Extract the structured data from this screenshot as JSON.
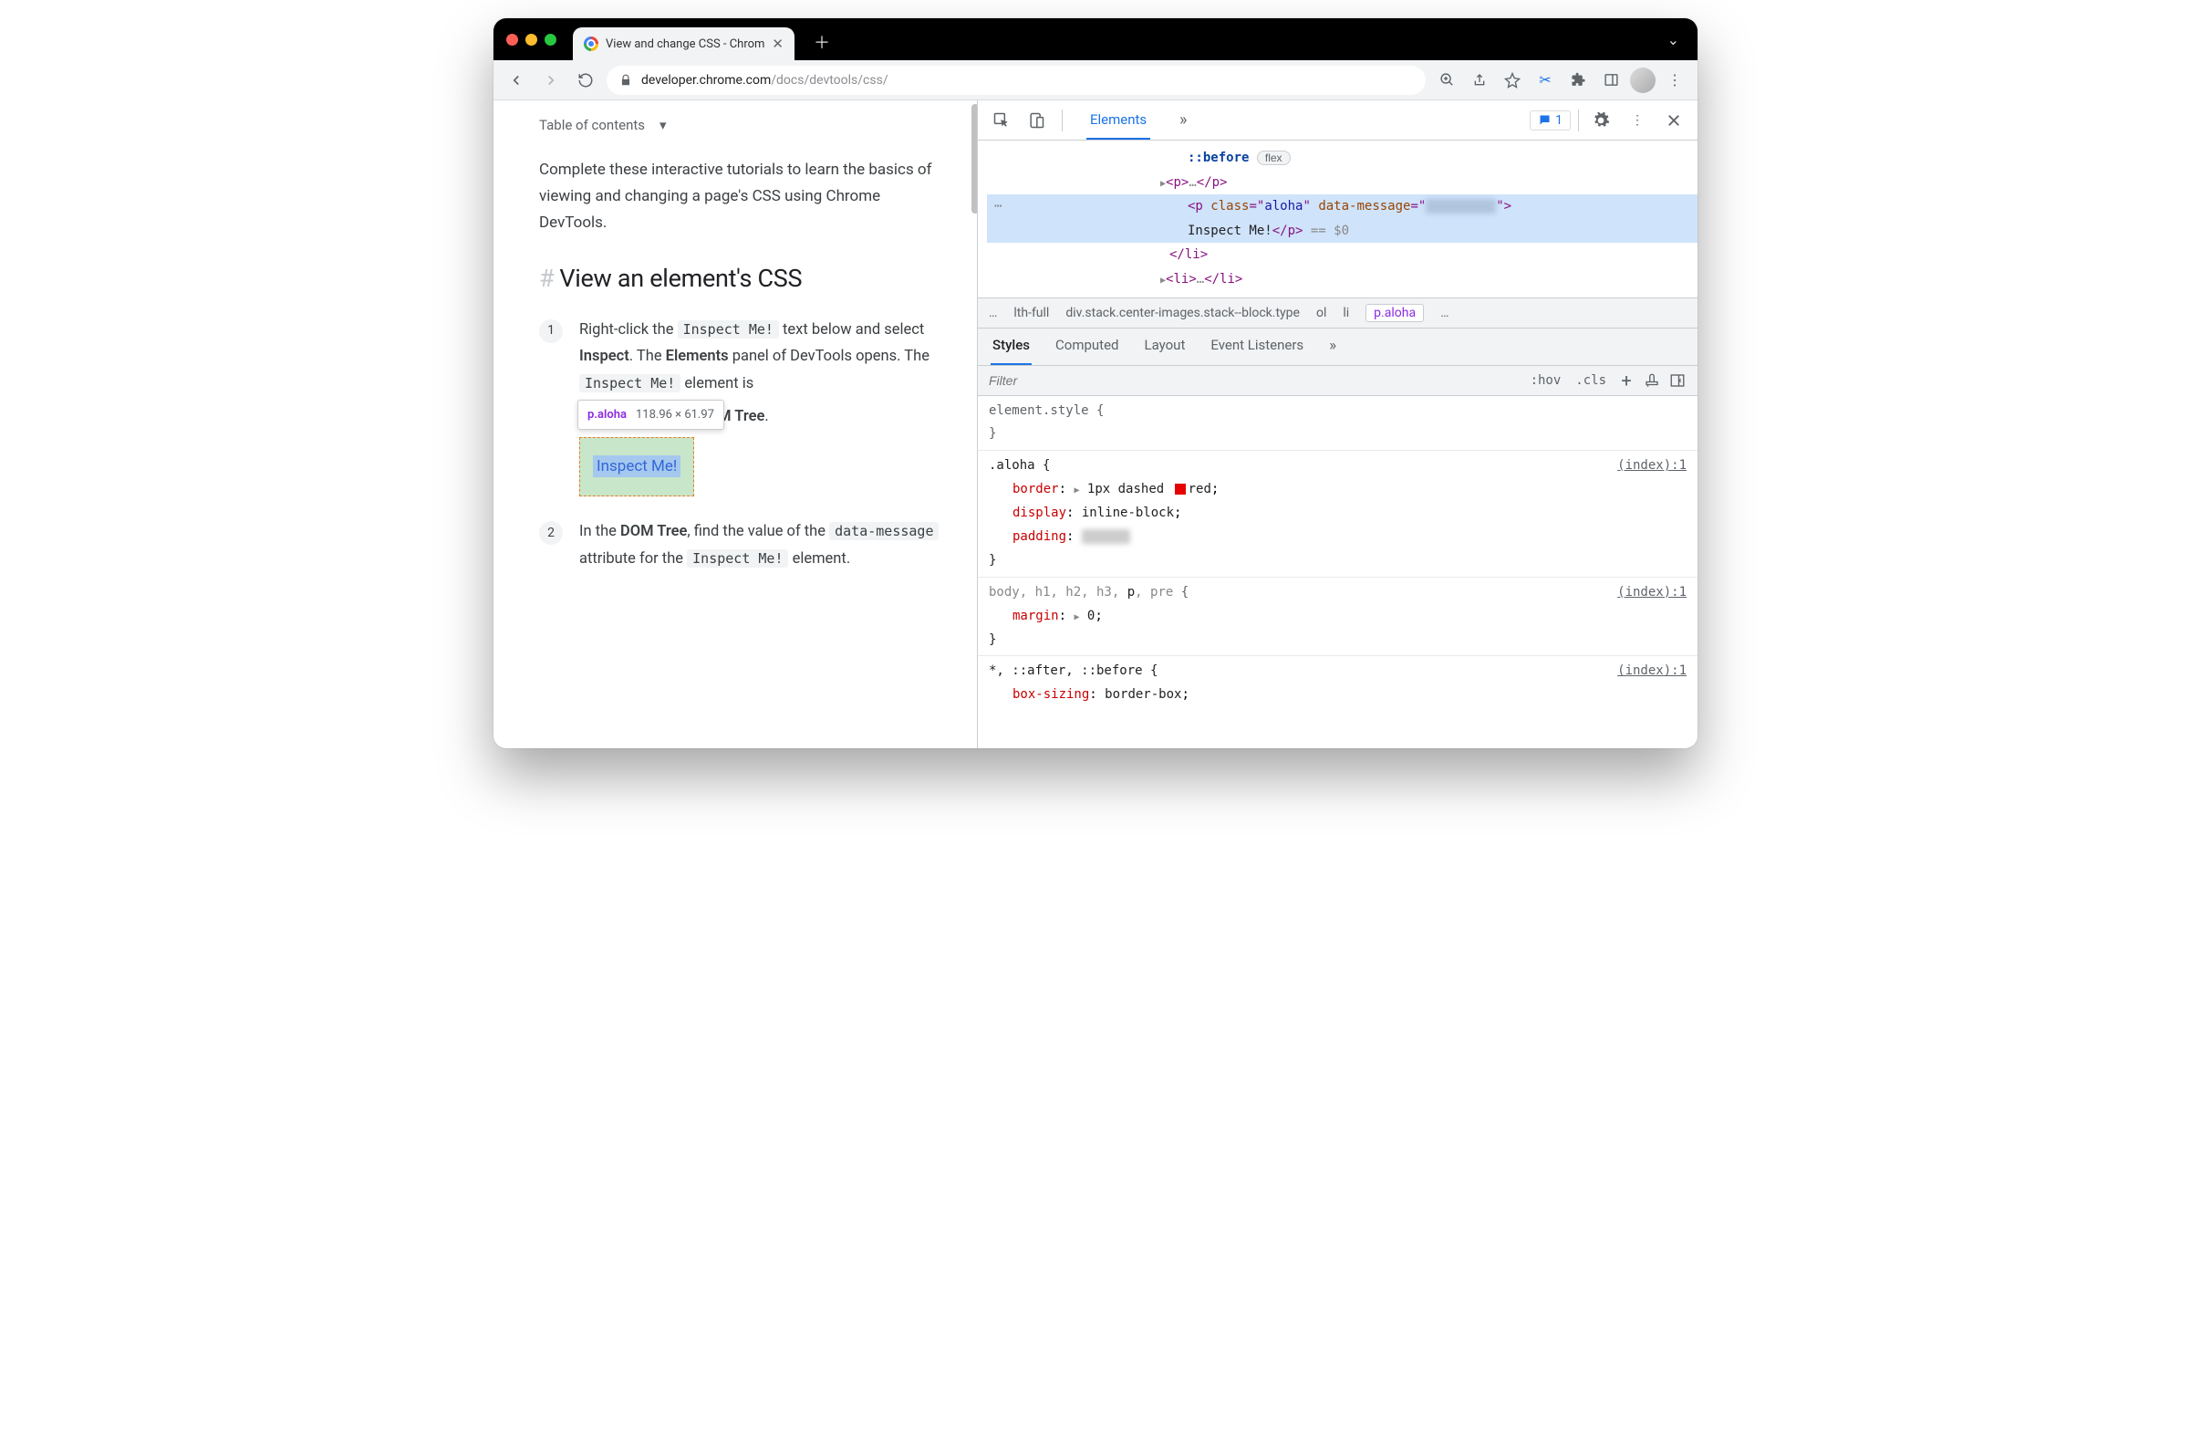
{
  "window": {
    "tab_title": "View and change CSS - Chrom",
    "url_host": "developer.chrome.com",
    "url_path": "/docs/devtools/css/"
  },
  "page": {
    "toc_label": "Table of contents",
    "intro": "Complete these interactive tutorials to learn the basics of viewing and changing a page's CSS using Chrome DevTools.",
    "heading": "View an element's CSS",
    "step1_a": "Right-click the ",
    "step1_code1": "Inspect Me!",
    "step1_b": " text below and select ",
    "step1_bold1": "Inspect",
    "step1_c": ". The ",
    "step1_bold2": "Elements",
    "step1_d": " panel of DevTools opens. The ",
    "step1_code2": "Inspect Me!",
    "step1_e": " element is",
    "step1_f_hidden_tail": "OM Tree",
    "step1_g": ".",
    "tooltip_selector": "p.aloha",
    "tooltip_dims": "118.96 × 61.97",
    "inspect_text": "Inspect Me!",
    "step2_a": "In the ",
    "step2_bold1": "DOM Tree",
    "step2_b": ", find the value of the ",
    "step2_code1": "data-message",
    "step2_c": " attribute for the ",
    "step2_code2": "Inspect Me!",
    "step2_d": " element."
  },
  "devtools": {
    "tabs": {
      "elements": "Elements"
    },
    "issue_count": "1",
    "tree": {
      "before": "::before",
      "flex_badge": "flex",
      "p_collapsed_open": "<p>",
      "p_collapsed_ellipsis": "…",
      "p_collapsed_close": "</p>",
      "sel_open": "<p class=\"aloha\" data-message=\"",
      "sel_close": "\">",
      "sel_text": "Inspect Me!",
      "sel_endtag": "</p>",
      "sel_marker": " == $0",
      "li_close": "</li>",
      "li_open": "<li>",
      "li_ellipsis": "…",
      "li_endtag": "</li>"
    },
    "crumbs": {
      "ellipsis_l": "…",
      "c1": "lth-full",
      "c2": "div.stack.center-images.stack--block.type",
      "c3": "ol",
      "c4": "li",
      "c5": "p.aloha",
      "ellipsis_r": "…"
    },
    "subtabs": {
      "styles": "Styles",
      "computed": "Computed",
      "layout": "Layout",
      "listeners": "Event Listeners"
    },
    "filter": {
      "placeholder": "Filter",
      "hov": ":hov",
      "cls": ".cls"
    },
    "rules": {
      "r0_sel": "element.style {",
      "r0_close": "}",
      "r1_sel": ".aloha {",
      "r1_src": "(index):1",
      "r1_p1_name": "border",
      "r1_p1_val_a": "1px dashed ",
      "r1_p1_val_b": "red",
      "r1_p2_name": "display",
      "r1_p2_val": "inline-block",
      "r1_p3_name": "padding",
      "r1_close": "}",
      "r2_sel": "body, h1, h2, h3, p, pre {",
      "r2_src": "(index):1",
      "r2_p1_name": "margin",
      "r2_p1_val": "0",
      "r2_close": "}",
      "r3_sel": "*, ::after, ::before {",
      "r3_src": "(index):1",
      "r3_p1_name": "box-sizing",
      "r3_p1_val": "border-box"
    }
  }
}
